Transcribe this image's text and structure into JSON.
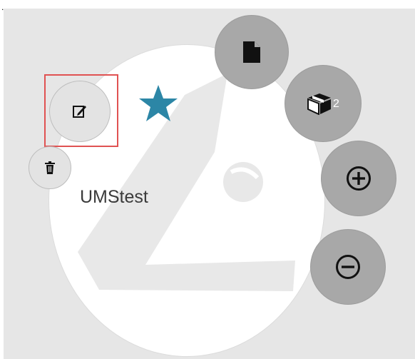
{
  "profile": {
    "name": "UMStest",
    "favorite_icon": "star-icon"
  },
  "actions": {
    "edit": {
      "icon": "edit-icon"
    },
    "delete": {
      "icon": "trash-icon"
    },
    "file": {
      "icon": "file-icon"
    },
    "packages": {
      "icon": "box-icon",
      "count": "2"
    },
    "zoom_in": {
      "icon": "plus-circle-icon"
    },
    "zoom_out": {
      "icon": "minus-circle-icon"
    }
  },
  "colors": {
    "panel_bg": "#e6e6e6",
    "button": "#a8a8a8",
    "star": "#2c86a6",
    "highlight": "#e05252"
  }
}
